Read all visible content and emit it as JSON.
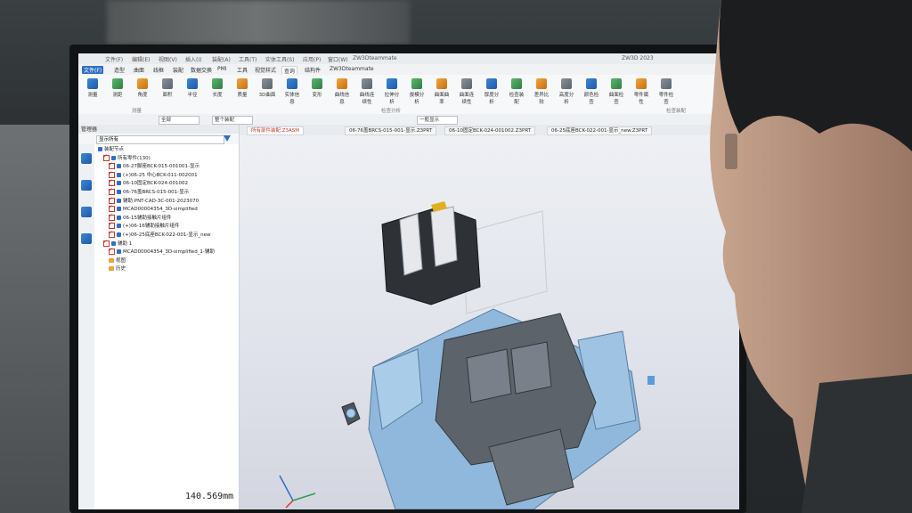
{
  "app": {
    "menu": [
      "文件(F)",
      "编辑(E)",
      "视图(V)",
      "插入(I)",
      "装配(A)",
      "工具(T)",
      "实体工具(S)",
      "应用(P)",
      "窗口(W)",
      "ZW3Dteammate"
    ],
    "window_title": "ZW3D 2023"
  },
  "ribbon_tabs": [
    {
      "label": "文件(F)",
      "state": "file"
    },
    {
      "label": "造型"
    },
    {
      "label": "曲面"
    },
    {
      "label": "线框"
    },
    {
      "label": "装配"
    },
    {
      "label": "数据交换"
    },
    {
      "label": "PMI"
    },
    {
      "label": "工具"
    },
    {
      "label": "视觉样式"
    },
    {
      "label": "查询",
      "state": "active"
    },
    {
      "label": "结构件"
    },
    {
      "label": "ZW3Dteammate"
    }
  ],
  "ribbon_tools": [
    {
      "label": "测量",
      "icon": "ruler-icon"
    },
    {
      "label": "测距",
      "icon": "distance-icon"
    },
    {
      "label": "角度",
      "icon": "angle-icon"
    },
    {
      "label": "面积",
      "icon": "area-icon"
    },
    {
      "label": "半径",
      "icon": "radius-icon"
    },
    {
      "label": "长度",
      "icon": "length-icon"
    },
    {
      "label": "质量",
      "icon": "mass-icon"
    },
    {
      "label": "3D曲面",
      "icon": "surface-icon"
    },
    {
      "label": "实体信息",
      "icon": "solid-info-icon"
    },
    {
      "label": "变形",
      "icon": "deform-icon"
    },
    {
      "label": "曲线信息",
      "icon": "curve-info-icon"
    },
    {
      "label": "曲线连续性",
      "icon": "continuity-icon"
    },
    {
      "label": "拉伸分析",
      "icon": "draft-icon"
    },
    {
      "label": "拔模分析",
      "icon": "draft-analysis-icon"
    },
    {
      "label": "曲面曲率",
      "icon": "curvature-icon"
    },
    {
      "label": "曲面连续性",
      "icon": "surface-continuity-icon"
    },
    {
      "label": "厚度分析",
      "icon": "thickness-icon"
    },
    {
      "label": "检查装配",
      "icon": "check-assembly-icon"
    },
    {
      "label": "差异比较",
      "icon": "compare-icon"
    },
    {
      "label": "高度分析",
      "icon": "height-icon"
    },
    {
      "label": "颜色检查",
      "icon": "color-check-icon"
    },
    {
      "label": "曲面检查",
      "icon": "surface-check-icon"
    },
    {
      "label": "零件属性",
      "icon": "part-props-icon"
    },
    {
      "label": "零件检查",
      "icon": "part-check-icon"
    }
  ],
  "ribbon_groups": [
    "测量",
    "检查分析",
    "检查装配"
  ],
  "quickbar": {
    "filter_combo": "全部",
    "select_combo": "整个装配",
    "mode_combo": "一般显示"
  },
  "left_panel": {
    "header": "管理器",
    "filter_placeholder": "显示所有",
    "tree": [
      {
        "label": "装配节点",
        "kind": "root"
      },
      {
        "label": "所有零件(130)",
        "kind": "group"
      },
      {
        "label": "06-27脚座BCK-015-001001-显示",
        "kind": "part"
      },
      {
        "label": "(+)06-25 中心BCK-011-002001",
        "kind": "part"
      },
      {
        "label": "06-10固定BCK-024-001002",
        "kind": "part"
      },
      {
        "label": "06-76盖BRCS-015-001-显示",
        "kind": "part"
      },
      {
        "label": "辅助 PNT-CAD-3C-001-2023070",
        "kind": "part"
      },
      {
        "label": "MCAD00004354_3D-simplified",
        "kind": "part"
      },
      {
        "label": "06-15辅助接触片组件",
        "kind": "part"
      },
      {
        "label": "(+)06-16辅助接触片组件",
        "kind": "part"
      },
      {
        "label": "(+)06-25底座BCK-022-001-显示_new",
        "kind": "part"
      },
      {
        "label": "辅助 1",
        "kind": "group"
      },
      {
        "label": "MCAD00004354_3D-simplified_1-辅助",
        "kind": "part"
      },
      {
        "label": "视图",
        "kind": "folder"
      },
      {
        "label": "历史",
        "kind": "folder"
      }
    ]
  },
  "doc_tabs": [
    {
      "label": "所有部件装配.Z3ASM",
      "active": true
    },
    {
      "label": "06-76盖BRCS-015-001-显示.Z3PRT"
    },
    {
      "label": "06-10固定BCK-024-001002.Z3PRT"
    },
    {
      "label": "06-25底座BCK-022-001-显示_new.Z3PRT"
    }
  ],
  "status": {
    "readout": "140.569mm"
  },
  "colors": {
    "accent": "#2f6fc2",
    "part_light": "#8fb8dc",
    "part_dark": "#3a3f45"
  }
}
